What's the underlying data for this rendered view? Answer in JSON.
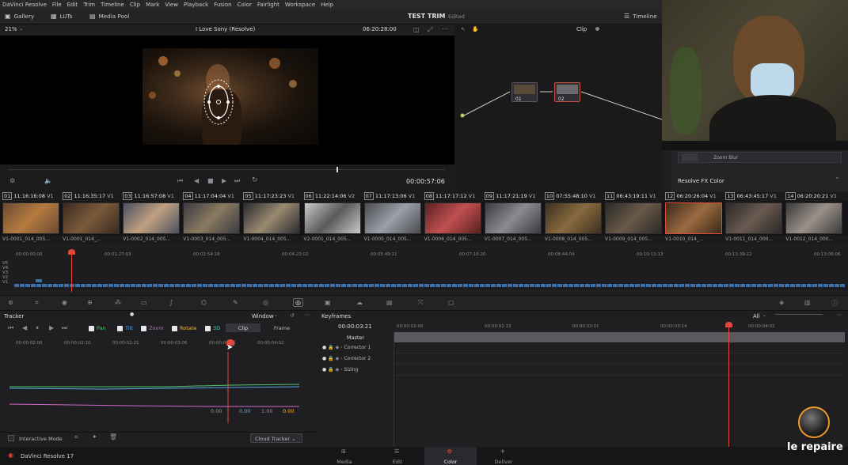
{
  "menu": [
    "DaVinci Resolve",
    "File",
    "Edit",
    "Trim",
    "Timeline",
    "Clip",
    "Mark",
    "View",
    "Playback",
    "Fusion",
    "Color",
    "Fairlight",
    "Workspace",
    "Help"
  ],
  "toolbar": {
    "gallery": "Gallery",
    "luts": "LUTs",
    "media_pool": "Media Pool",
    "project_title": "TEST TRIM",
    "edited": "Edited",
    "timeline": "Timeline"
  },
  "viewer": {
    "zoom": "21%",
    "clip_name": "I Love Sony (Resolve)",
    "timecode": "06:20:28:00",
    "playhead_tc": "00:00:57:06"
  },
  "nodes": {
    "mode": "Clip",
    "node1": "01",
    "node2": "02"
  },
  "fx": {
    "zoom_blur": "Zoom Blur",
    "title": "Resolve FX Color"
  },
  "clips": [
    {
      "n": "01",
      "tc": "11:16:16:08",
      "v": "V1",
      "name": "V1-0001_014_005..."
    },
    {
      "n": "02",
      "tc": "11:16:35:17",
      "v": "V1",
      "name": "V1-0001_014_..."
    },
    {
      "n": "03",
      "tc": "11:16:57:08",
      "v": "V1",
      "name": "V1-0002_014_005..."
    },
    {
      "n": "04",
      "tc": "11:17:04:04",
      "v": "V1",
      "name": "V1-0003_014_005..."
    },
    {
      "n": "05",
      "tc": "11:17:23:23",
      "v": "V1",
      "name": "V1-0004_014_005..."
    },
    {
      "n": "06",
      "tc": "11:22:14:06",
      "v": "V2",
      "name": "V2-0001_014_005..."
    },
    {
      "n": "07",
      "tc": "11:17:13:06",
      "v": "V1",
      "name": "V1-0005_014_005..."
    },
    {
      "n": "08",
      "tc": "11:17:17:12",
      "v": "V1",
      "name": "V1-0006_014_005..."
    },
    {
      "n": "09",
      "tc": "11:17:21:19",
      "v": "V1",
      "name": "V1-0007_014_005..."
    },
    {
      "n": "10",
      "tc": "07:55:48:10",
      "v": "V1",
      "name": "V1-0008_014_005..."
    },
    {
      "n": "11",
      "tc": "06:43:19:11",
      "v": "V1",
      "name": "V1-0009_014_005..."
    },
    {
      "n": "12",
      "tc": "06:20:26:04",
      "v": "V1",
      "name": "V1-0010_014_..."
    },
    {
      "n": "13",
      "tc": "06:43:45:17",
      "v": "V1",
      "name": "V1-0011_014_000..."
    },
    {
      "n": "14",
      "tc": "06:20:20:21",
      "v": "V1",
      "name": "V1-0012_014_000..."
    }
  ],
  "mini_timeline": {
    "ticks": [
      "00:00:00:00",
      "00:01:27:03",
      "00:02:54:18",
      "00:04:22:02",
      "00:05:49:11",
      "00:07:16:20",
      "00:08:44:04",
      "00:10:11:13",
      "00:11:39:22",
      "00:13:06:06"
    ],
    "tracks": [
      "V5",
      "V4",
      "V3",
      "V2",
      "V1"
    ]
  },
  "tracker": {
    "title": "Tracker",
    "mode": "Window",
    "checks": [
      "Pan",
      "Tilt",
      "Zoom",
      "Rotate",
      "3D"
    ],
    "clip": "Clip",
    "frame": "Frame",
    "ticks": [
      "00:00:02:00",
      "00:00:02:10",
      "00:00:02:21",
      "00:00:03:06",
      "00:00:03:16",
      "00:00:04:02"
    ],
    "vals": [
      "0.00",
      "0.00",
      "1.00",
      "0.00"
    ],
    "interactive": "Interactive Mode",
    "cloud": "Cloud Tracker"
  },
  "keyframes": {
    "title": "Keyframes",
    "filter": "All",
    "tc": "00:00:03:21",
    "ticks": [
      "00:00:02:00",
      "00:00:02:13",
      "00:00:03:01",
      "00:00:03:14",
      "00:00:04:02"
    ],
    "rows": [
      "Master",
      "Corrector 1",
      "Corrector 2",
      "Sizing"
    ]
  },
  "bottom": {
    "app": "DaVinci Resolve 17",
    "tabs": [
      "Media",
      "Edit",
      "Color",
      "Deliver"
    ],
    "brand": "le repaire"
  },
  "colors": {
    "accent": "#e0483c",
    "check_green": "#4fc36a",
    "check_blue": "#5aa7e8",
    "check_pink": "#d068c8",
    "check_orange": "#f0b64a",
    "check_teal": "#4fd6c8"
  }
}
